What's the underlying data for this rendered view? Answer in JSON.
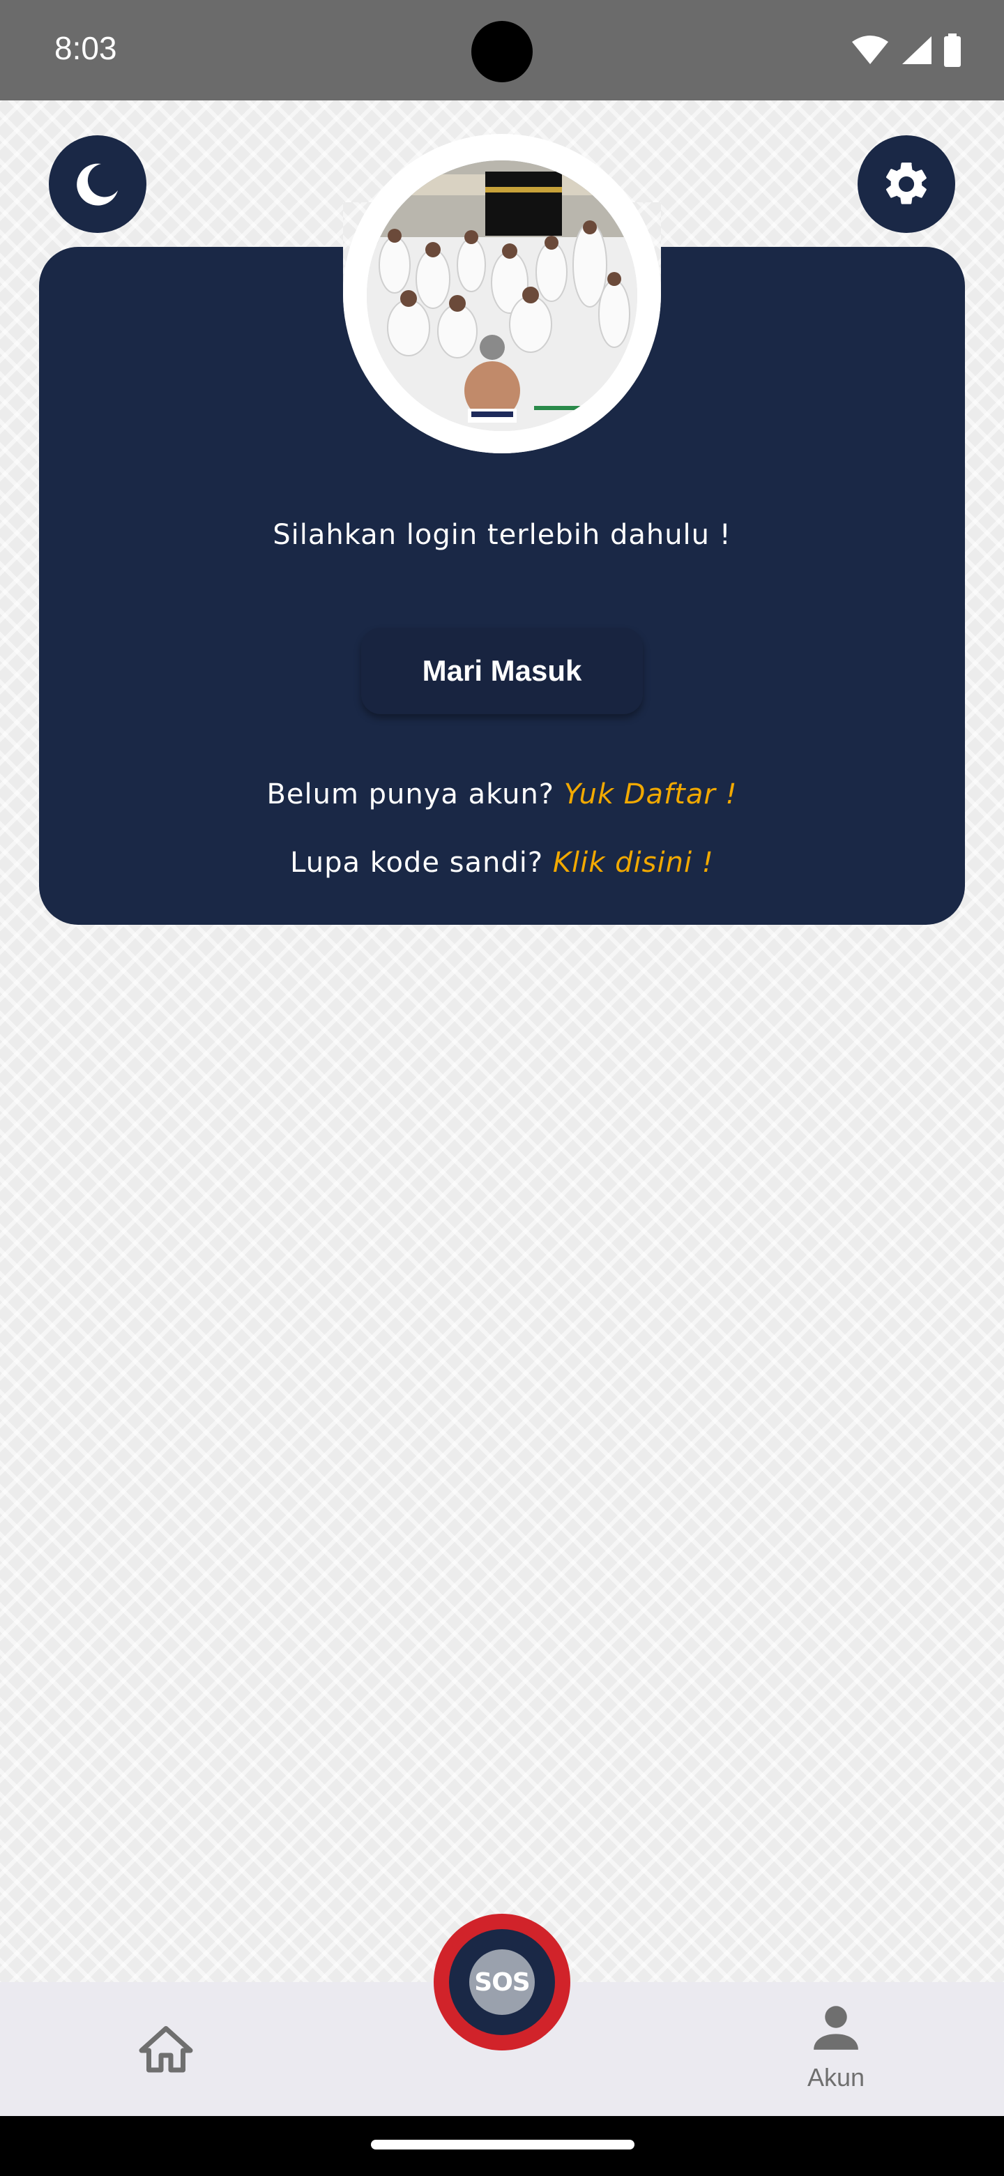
{
  "status_bar": {
    "time": "8:03",
    "icons": [
      "wifi-icon",
      "signal-icon",
      "battery-icon"
    ]
  },
  "header": {
    "theme_toggle_icon": "moon-icon",
    "settings_icon": "gear-icon"
  },
  "login_card": {
    "prompt": "Silahkan login terlebih dahulu !",
    "login_button_label": "Mari Masuk",
    "register_question": "Belum punya akun?",
    "register_link": "Yuk Daftar !",
    "forgot_question": "Lupa kode sandi?",
    "forgot_link": "Klik disini !"
  },
  "bottom_nav": {
    "items": [
      {
        "icon": "home-icon",
        "label": ""
      },
      {
        "icon": "sos-icon",
        "label": "SOS"
      },
      {
        "icon": "person-icon",
        "label": "Akun"
      }
    ]
  },
  "colors": {
    "navy": "#1a2846",
    "accent_link": "#f2a900",
    "sos_red": "#d1232a",
    "status_bar": "#6b6b6b"
  }
}
